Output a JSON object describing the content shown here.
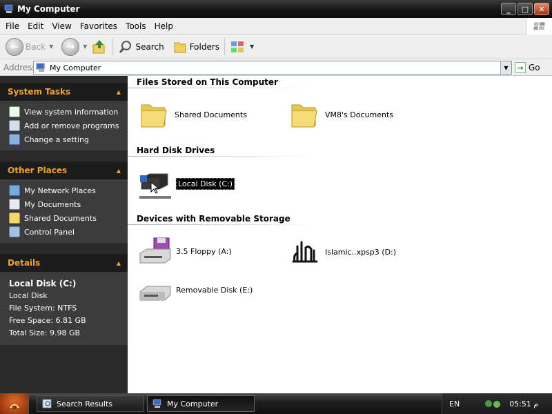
{
  "window": {
    "title": "My Computer",
    "minimize_glyph": "_",
    "maximize_glyph": "□",
    "close_glyph": "✕"
  },
  "menu": [
    "File",
    "Edit",
    "View",
    "Favorites",
    "Tools",
    "Help"
  ],
  "toolbar": {
    "back": "Back",
    "search": "Search",
    "folders": "Folders"
  },
  "address": {
    "label": "Address",
    "value": "My Computer",
    "go": "Go"
  },
  "sidebar": {
    "system_tasks": {
      "title": "System Tasks",
      "items": [
        "View system information",
        "Add or remove programs",
        "Change a setting"
      ]
    },
    "other_places": {
      "title": "Other Places",
      "items": [
        "My Network Places",
        "My Documents",
        "Shared Documents",
        "Control Panel"
      ]
    },
    "details": {
      "title": "Details",
      "name": "Local Disk (C:)",
      "type": "Local Disk",
      "file_system": "File System: NTFS",
      "free_space": "Free Space: 6.81 GB",
      "total_size": "Total Size: 9.98 GB"
    }
  },
  "content": {
    "groups": [
      {
        "title": "Files Stored on This Computer",
        "items": [
          "Shared Documents",
          "VM8's Documents"
        ]
      },
      {
        "title": "Hard Disk Drives",
        "items": [
          "Local Disk (C:)"
        ]
      },
      {
        "title": "Devices with Removable Storage",
        "items": [
          "3.5 Floppy (A:)",
          "Islamic..xpsp3 (D:)",
          "Removable Disk (E:)"
        ]
      }
    ]
  },
  "taskbar": {
    "buttons": [
      "Search Results",
      "My Computer"
    ],
    "language": "EN",
    "clock": "05:51 م"
  },
  "colors": {
    "sidebar_bg": "#3c3c3c",
    "sidebar_header_text": "#f2a230",
    "selection_bg": "#000000"
  }
}
